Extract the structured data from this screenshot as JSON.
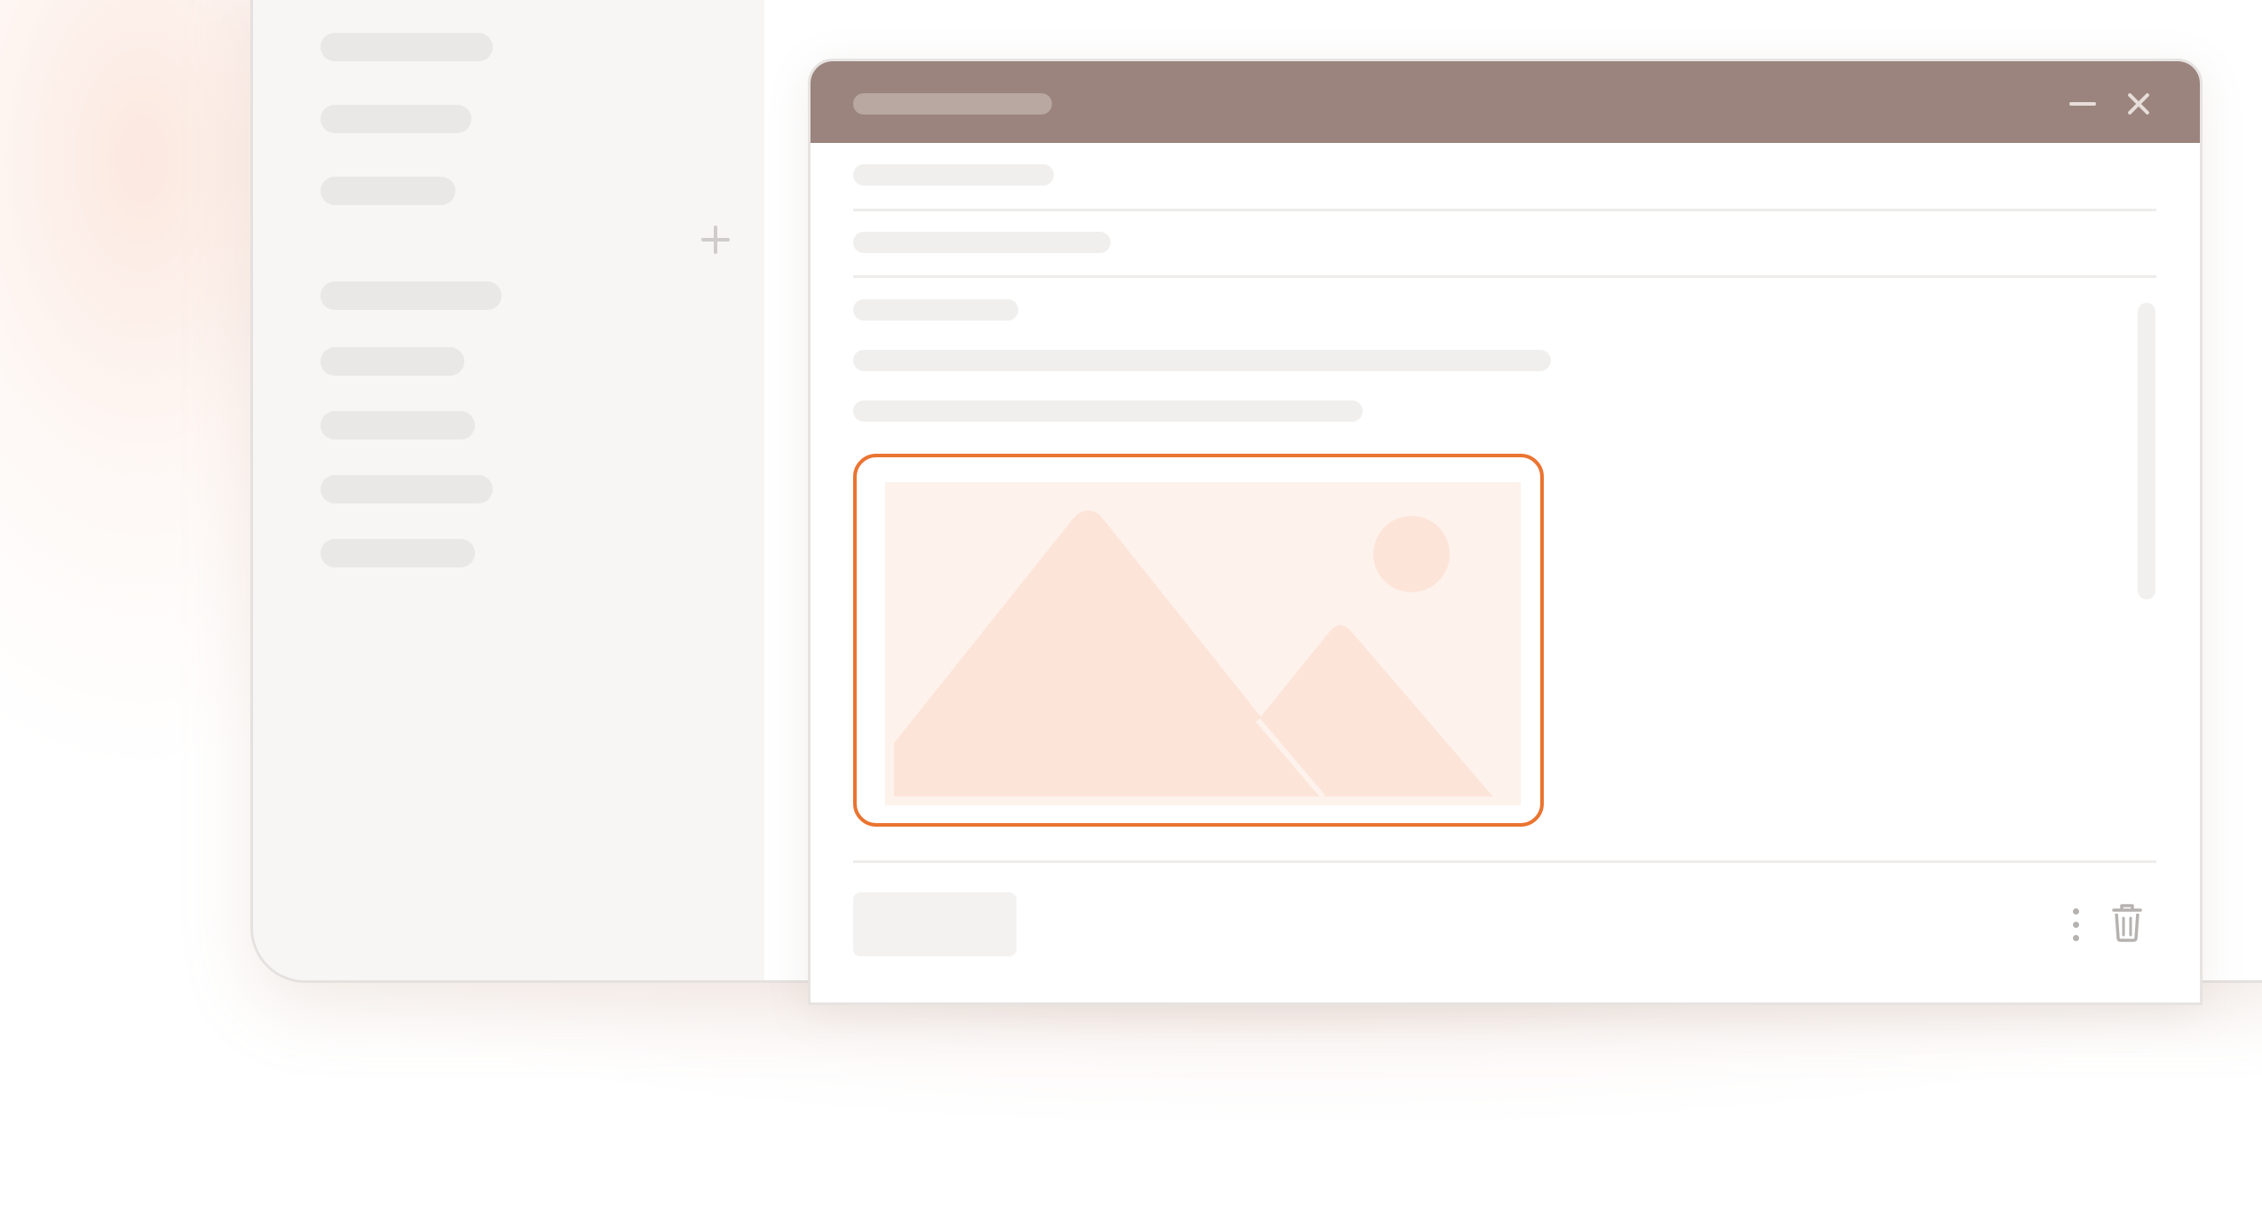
{
  "app": {
    "window_title": ""
  },
  "sidebar": {
    "add_icon": "plus-icon"
  },
  "dialog": {
    "title": "",
    "minimize_icon": "minimize-icon",
    "close_icon": "close-icon",
    "image_placeholder_icon": "image-placeholder-icon",
    "more_icon": "more-vertical-icon",
    "delete_icon": "trash-icon",
    "send_label": ""
  },
  "colors": {
    "titlebar": "#9a847d",
    "accent_outline": "#ea7431",
    "image_bg": "#fdf2ec",
    "image_shapes": "#fde4d9",
    "sidebar_bg": "#f7f6f5",
    "skeleton": "#e9e8e6"
  }
}
